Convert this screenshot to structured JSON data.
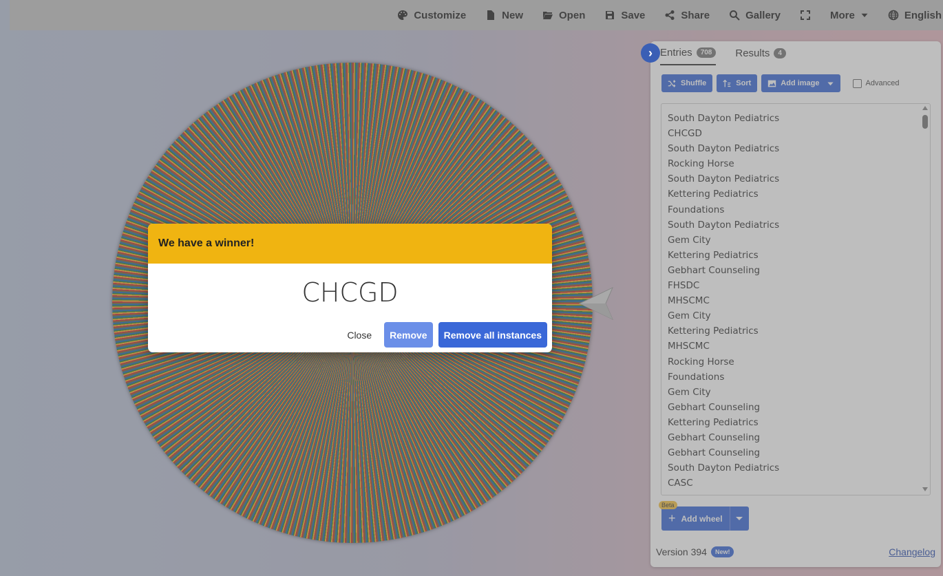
{
  "topbar": {
    "items": [
      {
        "label": "Customize",
        "icon": "palette-icon"
      },
      {
        "label": "New",
        "icon": "file-icon"
      },
      {
        "label": "Open",
        "icon": "folder-open-icon"
      },
      {
        "label": "Save",
        "icon": "save-icon"
      },
      {
        "label": "Share",
        "icon": "share-icon"
      },
      {
        "label": "Gallery",
        "icon": "search-icon"
      },
      {
        "label": "",
        "icon": "fullscreen-icon"
      },
      {
        "label": "More",
        "icon": "caret-down-icon"
      },
      {
        "label": "English",
        "icon": "globe-icon"
      }
    ]
  },
  "panel": {
    "tabs": [
      {
        "label": "Entries",
        "count": "708"
      },
      {
        "label": "Results",
        "count": "4"
      }
    ],
    "toolbar": {
      "shuffle": "Shuffle",
      "sort": "Sort",
      "add_image": "Add image",
      "advanced": "Advanced"
    },
    "entries": [
      "South Dayton Pediatrics",
      "CHCGD",
      "South Dayton Pediatrics",
      "Rocking Horse",
      "South Dayton Pediatrics",
      "Kettering Pediatrics",
      "Foundations",
      "South Dayton Pediatrics",
      "Gem City",
      "Kettering Pediatrics",
      "Gebhart Counseling",
      "FHSDC",
      "MHSCMC",
      "Gem City",
      "Kettering Pediatrics",
      "MHSCMC",
      "Rocking Horse",
      "Foundations",
      "Gem City",
      "Gebhart Counseling",
      "Kettering Pediatrics",
      "Gebhart Counseling",
      "Gebhart Counseling",
      "South Dayton Pediatrics",
      "CASC"
    ],
    "beta": "Beta",
    "add_wheel": "Add wheel",
    "version": "Version 394",
    "new_badge": "New!",
    "changelog": "Changelog"
  },
  "dialog": {
    "header": "We have a winner!",
    "winner": "CHCGD",
    "close": "Close",
    "remove": "Remove",
    "remove_all": "Remove all instances"
  },
  "colors": {
    "accent": "#3a68d8",
    "dialog_header": "#f0b411"
  }
}
